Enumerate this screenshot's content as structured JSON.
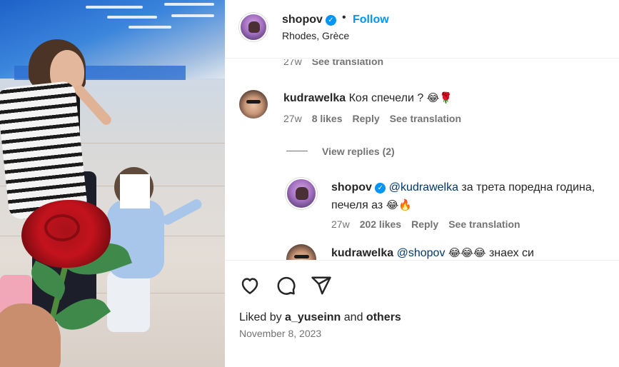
{
  "post": {
    "username": "shopov",
    "follow_label": "Follow",
    "dot": "•",
    "location": "Rhodes, Grèce",
    "verified_icon": "verified-badge-icon",
    "accent_color": "#0095f6"
  },
  "comments": {
    "prev_meta": {
      "age": "27w",
      "translate": "See translation"
    },
    "c1": {
      "username": "kudrawelka",
      "text": "Коя спечели ?",
      "emoji": "😂🌹",
      "age": "27w",
      "likes": "8 likes",
      "reply": "Reply",
      "translate": "See translation"
    },
    "view_replies": "View replies (2)",
    "r1": {
      "username": "shopov",
      "mention": "@kudrawelka",
      "text_line1": "за трета поредна година,",
      "text_line2": "печеля аз",
      "emoji": "😂🔥",
      "age": "27w",
      "likes": "202 likes",
      "reply": "Reply",
      "translate": "See translation"
    },
    "r2": {
      "username": "kudrawelka",
      "mention": "@shopov",
      "emoji": "😂😂😂",
      "text": "знаех си"
    }
  },
  "actions": {
    "like_icon": "heart-icon",
    "comment_icon": "comment-icon",
    "share_icon": "share-icon",
    "liked_by_prefix": "Liked by",
    "liked_by_user": "a_yuseinn",
    "liked_by_and": "and",
    "liked_by_others": "others",
    "date": "November 8, 2023"
  }
}
